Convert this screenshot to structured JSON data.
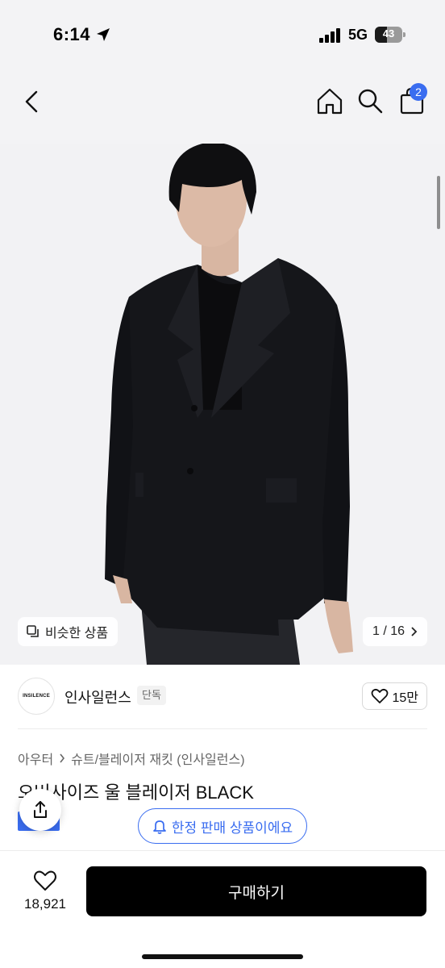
{
  "status_bar": {
    "time": "6:14",
    "network": "5G",
    "battery": "43"
  },
  "nav": {
    "cart_count": "2",
    "icons": [
      "chevron-left-icon",
      "home-icon",
      "search-icon",
      "shopping-bag-icon"
    ]
  },
  "gallery": {
    "similar_label": "비슷한 상품",
    "page_counter": "1 / 16",
    "current_page": 1,
    "total_pages": 16
  },
  "seller": {
    "logo_text": "INSILENCE",
    "name": "인사일런스",
    "tag": "단독",
    "likes": "15만"
  },
  "product": {
    "breadcrumb": [
      "아우터",
      "슈트/블레이저 재킷 (인사일런스)"
    ],
    "title": "오버사이즈 울 블레이저 BLACK",
    "limited_label": "한정 판매 상품이에요"
  },
  "bottom_bar": {
    "wish_count": "18,921",
    "buy_label": "구매하기"
  },
  "colors": {
    "accent": "#3a6df0",
    "buy_button": "#000000",
    "jacket": "#15161a"
  }
}
